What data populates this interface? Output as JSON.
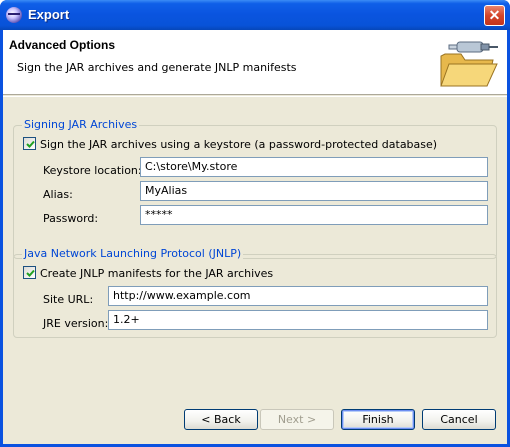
{
  "window": {
    "title": "Export",
    "close_label": "✕"
  },
  "header": {
    "title": "Advanced Options",
    "description": "Sign the JAR archives and generate JNLP manifests",
    "image_icon": "folder-plug-icon"
  },
  "signing": {
    "group_title": "Signing JAR Archives",
    "checkbox_label": "Sign the JAR archives using a keystore (a password-protected database)",
    "checked": true,
    "keystore_label": "Keystore location:",
    "keystore_value": "C:\\store\\My.store",
    "alias_label": "Alias:",
    "alias_value": "MyAlias",
    "password_label": "Password:",
    "password_value": "*****"
  },
  "jnlp": {
    "group_title": "Java Network Launching Protocol (JNLP)",
    "checkbox_label": "Create JNLP manifests for the JAR archives",
    "checked": true,
    "site_url_label": "Site URL:",
    "site_url_value": "http://www.example.com",
    "jre_version_label": "JRE version:",
    "jre_version_value": "1.2+"
  },
  "buttons": {
    "back": "< Back",
    "next": "Next >",
    "finish": "Finish",
    "cancel": "Cancel"
  },
  "colors": {
    "titlebar": "#0a54df",
    "group_title": "#0046d5",
    "dialog_bg": "#ece9d8"
  }
}
